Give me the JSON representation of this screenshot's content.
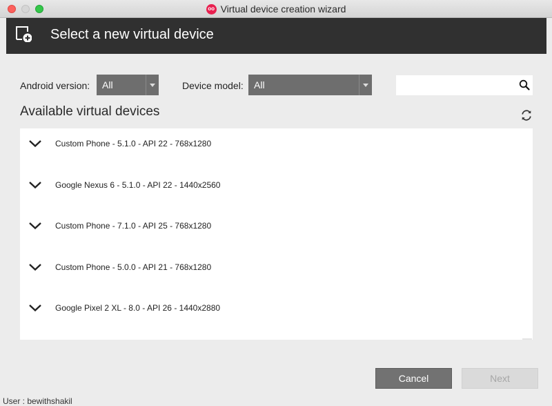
{
  "window": {
    "title": "Virtual device creation wizard"
  },
  "header": {
    "title": "Select a new virtual device"
  },
  "filters": {
    "android_version_label": "Android version:",
    "android_version_value": "All",
    "device_model_label": "Device model:",
    "device_model_value": "All",
    "search_placeholder": ""
  },
  "list": {
    "title": "Available virtual devices",
    "devices": [
      "Custom Phone - 5.1.0 - API 22 - 768x1280",
      "Google Nexus 6 - 5.1.0 - API 22 - 1440x2560",
      "Custom Phone - 7.1.0 - API 25 - 768x1280",
      "Custom Phone - 5.0.0 - API 21 - 768x1280",
      "Google Pixel 2 XL - 8.0 - API 26 - 1440x2880"
    ]
  },
  "buttons": {
    "cancel": "Cancel",
    "next": "Next"
  },
  "footer": {
    "text": "User : bewithshakil"
  },
  "colors": {
    "header_bg": "#303030",
    "select_bg": "#6e6e6e",
    "cancel_bg": "#727272",
    "next_bg": "#dadada",
    "app_icon": "#e8204f"
  }
}
